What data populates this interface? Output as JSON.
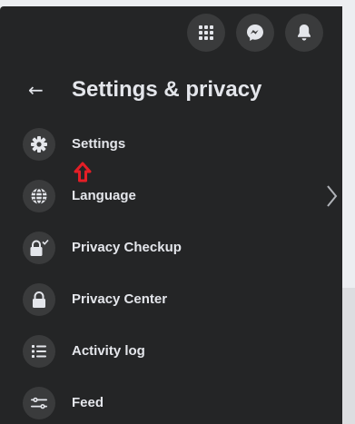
{
  "header": {
    "back_icon": "arrow-left-icon",
    "title": "Settings & privacy"
  },
  "topbar": {
    "buttons": [
      {
        "icon": "menu-grid-icon"
      },
      {
        "icon": "messenger-icon"
      },
      {
        "icon": "bell-icon"
      }
    ]
  },
  "menu": {
    "items": [
      {
        "label": "Settings",
        "icon": "gear-icon"
      },
      {
        "label": "Language",
        "icon": "globe-icon",
        "has_chevron": true
      },
      {
        "label": "Privacy Checkup",
        "icon": "lock-check-icon"
      },
      {
        "label": "Privacy Center",
        "icon": "lock-icon"
      },
      {
        "label": "Activity log",
        "icon": "list-icon"
      },
      {
        "label": "Feed",
        "icon": "sliders-icon"
      }
    ]
  },
  "annotation": {
    "icon": "red-up-arrow-icon",
    "color": "#e41e26"
  },
  "colors": {
    "panel": "#242526",
    "text": "#e4e6eb",
    "icon_bg": "#3a3b3c"
  }
}
